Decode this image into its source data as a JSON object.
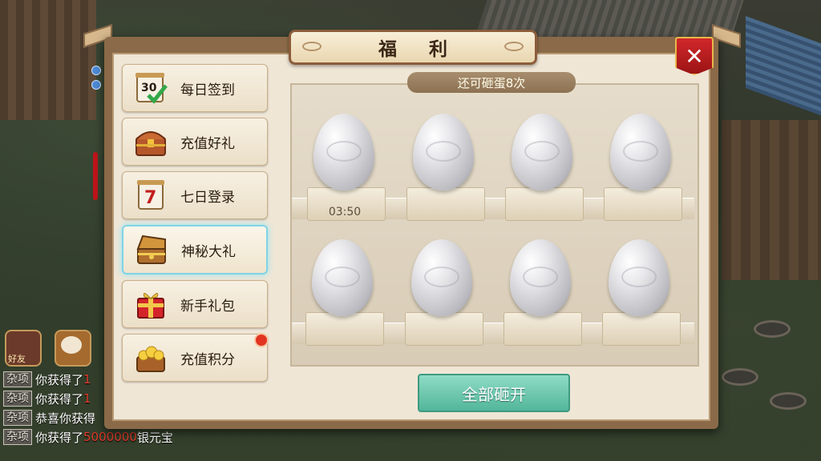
{
  "window": {
    "title": "福 利"
  },
  "menu": {
    "items": [
      {
        "label": "每日签到",
        "icon": "calendar-30-checkmark-icon",
        "active": false,
        "badge": false
      },
      {
        "label": "充值好礼",
        "icon": "treasure-chest-icon",
        "active": false,
        "badge": false
      },
      {
        "label": "七日登录",
        "icon": "calendar-7-icon",
        "active": false,
        "badge": false
      },
      {
        "label": "神秘大礼",
        "icon": "mystery-chest-icon",
        "active": true,
        "badge": false
      },
      {
        "label": "新手礼包",
        "icon": "gift-box-icon",
        "active": false,
        "badge": false
      },
      {
        "label": "充值积分",
        "icon": "gold-treasure-icon",
        "active": false,
        "badge": true
      }
    ]
  },
  "eggs": {
    "remaining_text": "还可砸蛋8次",
    "timer": "03:50",
    "smash_all_label": "全部砸开"
  },
  "hud": {
    "friend_label": "好友"
  },
  "chat": [
    {
      "tag": "杂项",
      "text": "你获得了",
      "num": "1",
      "tail": ""
    },
    {
      "tag": "杂项",
      "text": "你获得了",
      "num": "1",
      "tail": ""
    },
    {
      "tag": "杂项",
      "text": "恭喜你获得",
      "num": "",
      "tail": ""
    },
    {
      "tag": "杂项",
      "text": "你获得了",
      "num": "5000000",
      "tail": "银元宝"
    }
  ],
  "colors": {
    "panel_frame": "#8a6a48",
    "panel_bg": "#efe6d6",
    "close_red": "#c01f22",
    "active_glow": "#7fd3e6",
    "smash_green": "#52b69a",
    "chat_number_red": "#e03c2c"
  }
}
